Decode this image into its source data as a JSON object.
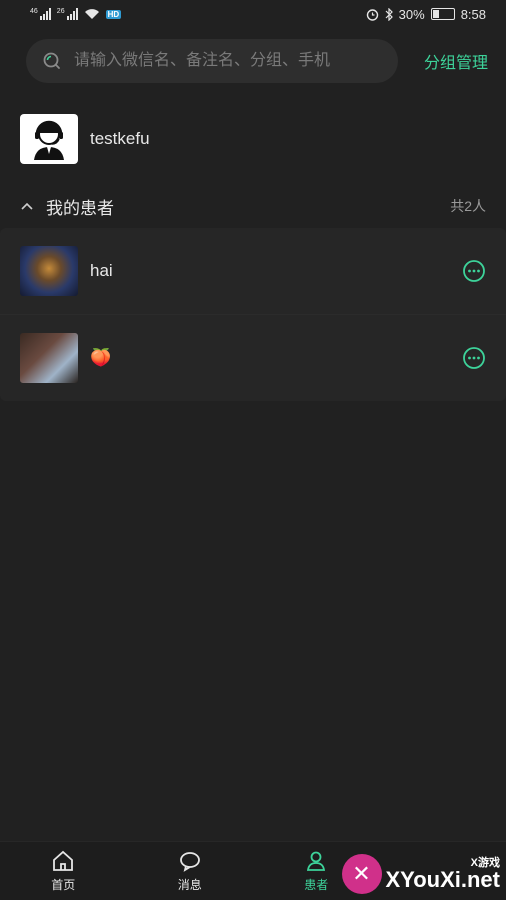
{
  "status_bar": {
    "left_sig1": "46",
    "left_sig2": "26",
    "hd_badge": "HD",
    "battery": "30%",
    "time": "8:58"
  },
  "search": {
    "placeholder": "请输入微信名、备注名、分组、手机",
    "icon": "search-icon"
  },
  "group_manage_label": "分组管理",
  "kefu": {
    "name": "testkefu",
    "icon": "customer-service-avatar"
  },
  "section": {
    "title": "我的患者",
    "count": "共2人"
  },
  "patients": [
    {
      "name": "hai"
    },
    {
      "name": "🍑"
    }
  ],
  "tabbar": {
    "tabs": [
      {
        "label": "首页",
        "icon": "home-icon"
      },
      {
        "label": "消息",
        "icon": "message-icon"
      },
      {
        "label": "患者",
        "icon": "user-icon"
      },
      {
        "label": "",
        "icon": ""
      }
    ]
  },
  "watermark": {
    "line1": "X游戏",
    "line2": "XYouXi.net"
  },
  "colors": {
    "accent": "#3dd39a",
    "background": "#212121"
  }
}
